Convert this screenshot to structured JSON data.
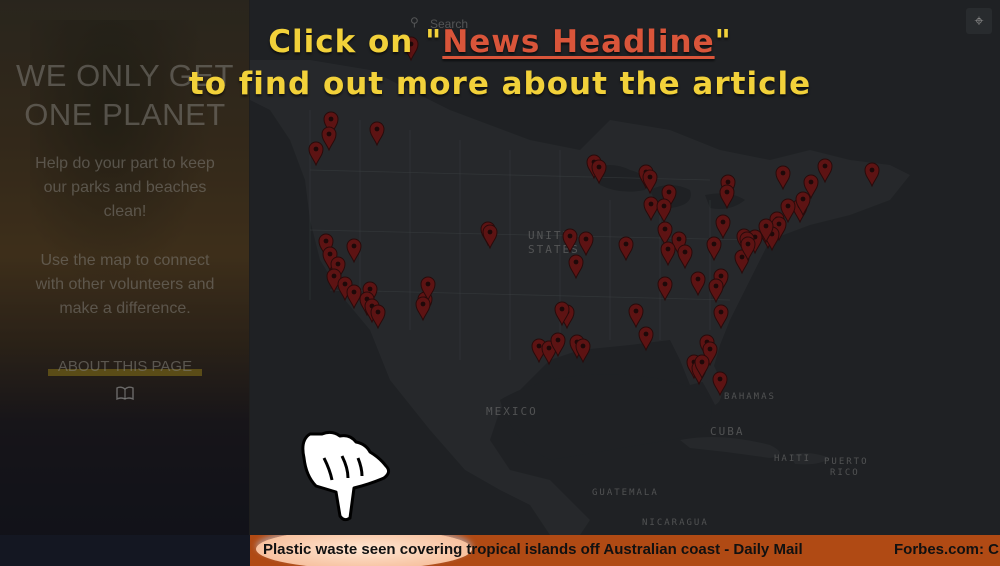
{
  "sidebar": {
    "title_line1": "WE ONLY GET",
    "title_line2": "ONE PLANET",
    "para1_line1": "Help do your part to keep",
    "para1_line2": "our parks and beaches",
    "para1_line3": "clean!",
    "para2_line1": "Use the map to connect",
    "para2_line2": "with other volunteers and",
    "para2_line3": "make a difference.",
    "about_label": "ABOUT THIS PAGE",
    "book_icon": "book-icon"
  },
  "map": {
    "search_placeholder": "Search",
    "labels": {
      "united": "UNITED",
      "states": "STATES",
      "mexico": "MEXICO",
      "cuba": "CUBA",
      "bahamas": "BAHAMAS",
      "haiti": "HAITI",
      "puerto1": "PUERTO",
      "puerto2": "RICO",
      "guatemala": "GUATEMALA",
      "nicaragua": "NICARAGUA"
    },
    "marker_color": "#8b1a1a",
    "marker_count": 78
  },
  "instruction": {
    "line1_pre": "Click on \"",
    "line1_link": "News Headline",
    "line1_post": "\"",
    "line2": "to find out more about the article"
  },
  "ticker": {
    "headline1": "Plastic waste seen covering tropical islands off Australian coast - Daily Mail",
    "headline2": "Forbes.com: C"
  },
  "colors": {
    "instruction_yellow": "#f2d13a",
    "link_red": "#d9553a",
    "ticker_bg": "#b04a14"
  }
}
